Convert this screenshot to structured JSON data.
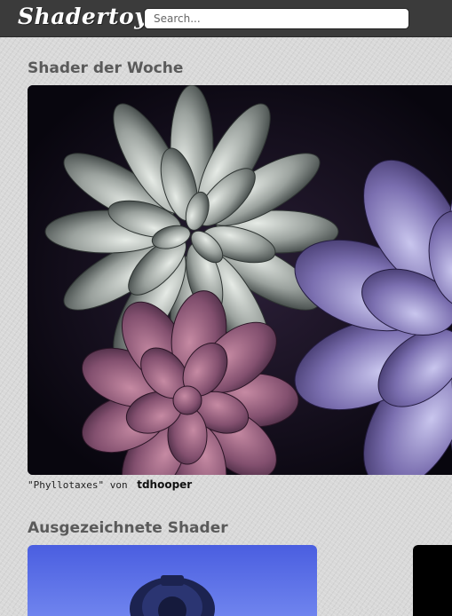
{
  "header": {
    "logo_text": "Shadertoy",
    "search_placeholder": "Search..."
  },
  "shader_of_week": {
    "section_title": "Shader der Woche",
    "name_quoted": "\"Phyllotaxes\"",
    "by_word": "von",
    "author": "tdhooper"
  },
  "featured": {
    "section_title": "Ausgezeichnete Shader"
  },
  "colors": {
    "topbar": "#3b3b3b",
    "page_background": "#d9d9d9",
    "section_title": "#5a5a5a"
  }
}
